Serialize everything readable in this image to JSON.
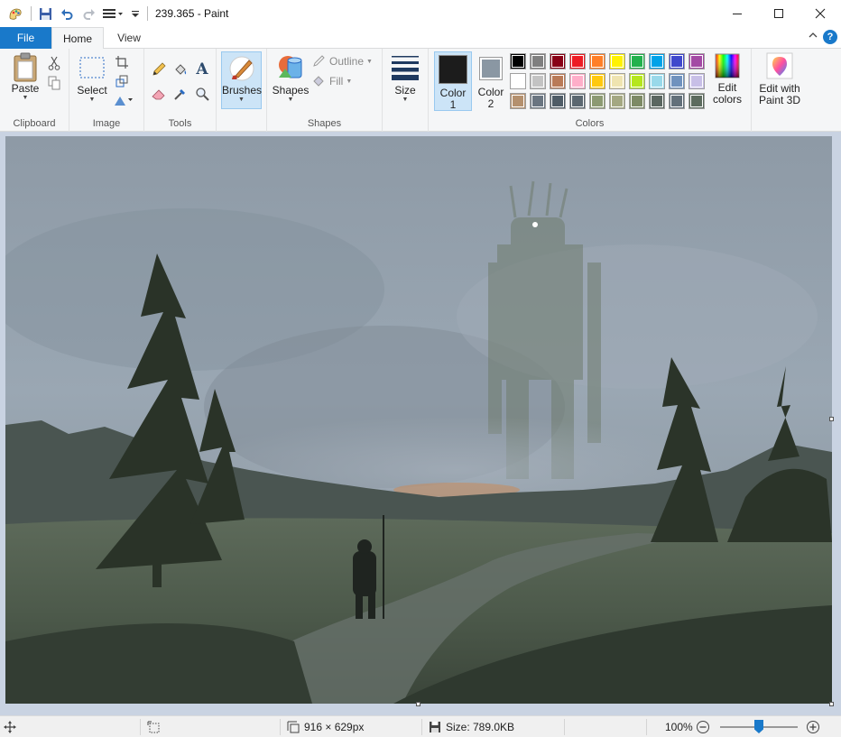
{
  "titlebar": {
    "title": "239.365 - Paint",
    "minimize_glyph": "—",
    "maximize_glyph": "☐",
    "close_glyph": "✕"
  },
  "tabs": {
    "file": "File",
    "home": "Home",
    "view": "View",
    "collapse_glyph": "^",
    "help_glyph": "?"
  },
  "ribbon": {
    "clipboard": {
      "group_label": "Clipboard",
      "paste_label": "Paste"
    },
    "image": {
      "group_label": "Image",
      "select_label": "Select"
    },
    "tools": {
      "group_label": "Tools"
    },
    "brushes": {
      "label": "Brushes"
    },
    "shapes": {
      "group_label": "Shapes",
      "shapes_label": "Shapes",
      "outline_label": "Outline",
      "fill_label": "Fill"
    },
    "size": {
      "label": "Size"
    },
    "colors": {
      "group_label": "Colors",
      "color1_label": "Color",
      "color1_num": "1",
      "color2_label": "Color",
      "color2_num": "2",
      "color1_value": "#1c1c1c",
      "color2_value": "#8a97a3",
      "edit_colors_line1": "Edit",
      "edit_colors_line2": "colors",
      "palette_row1": [
        "#000000",
        "#7f7f7f",
        "#880015",
        "#ed1c24",
        "#ff7f27",
        "#fff200",
        "#22b14c",
        "#00a2e8",
        "#3f48cc",
        "#a349a4"
      ],
      "palette_row2": [
        "#ffffff",
        "#c3c3c3",
        "#b97a57",
        "#ffaec9",
        "#ffc90e",
        "#efe4b0",
        "#b5e61d",
        "#99d9ea",
        "#7092be",
        "#c8bfe7"
      ],
      "palette_row3": [
        "#b4906e",
        "#6a7580",
        "#4f5c66",
        "#5b6770",
        "#8c9a72",
        "#a4a882",
        "#7d8a65",
        "#5a6660",
        "#62707a",
        "#5c6b5e"
      ]
    },
    "paint3d": {
      "line1": "Edit with",
      "line2": "Paint 3D"
    }
  },
  "status": {
    "dimensions": "916 × 629px",
    "file_size": "Size: 789.0KB",
    "zoom": "100%",
    "zoom_out_glyph": "−",
    "zoom_in_glyph": "+"
  }
}
